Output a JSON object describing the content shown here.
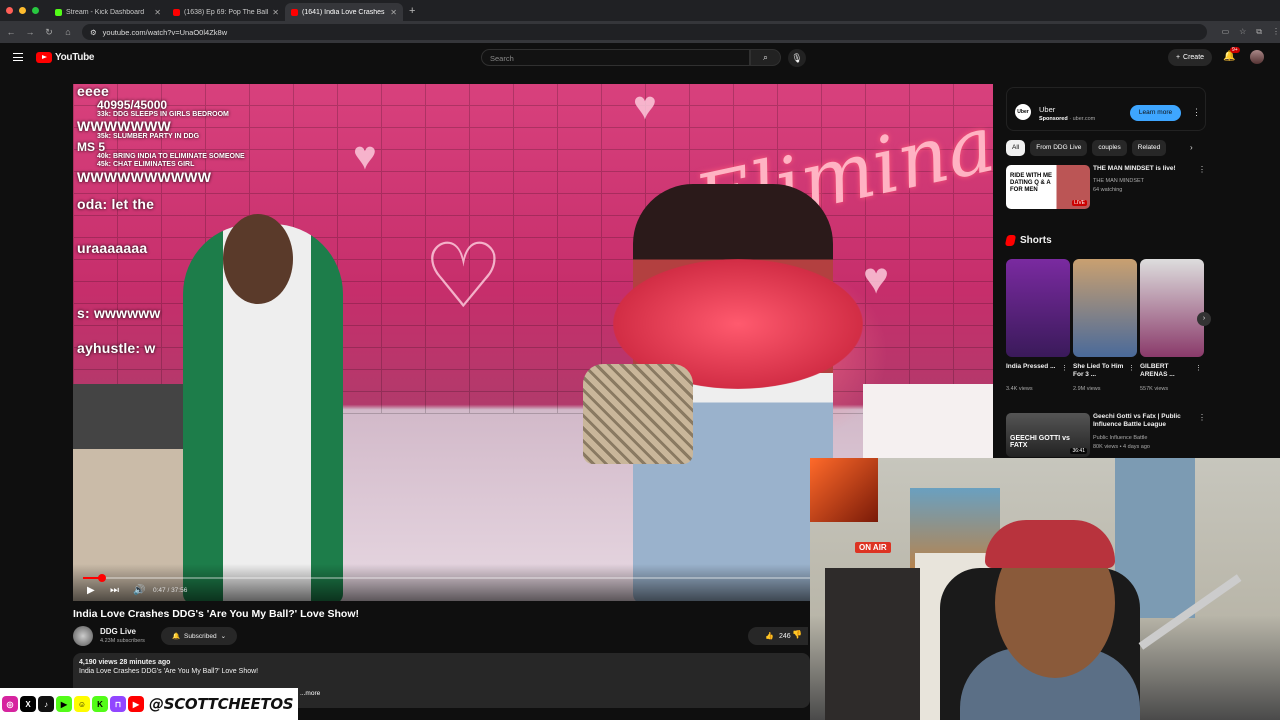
{
  "browser": {
    "tabs": [
      {
        "title": "Stream - Kick Dashboard",
        "color": "#53fc18",
        "active": false
      },
      {
        "title": "(1638) Ep 69: Pop The Balloo",
        "color": "#ff0000",
        "active": false
      },
      {
        "title": "(1641) India Love Crashes DDG",
        "color": "#ff0000",
        "active": true
      }
    ],
    "url": "youtube.com/watch?v=UnaO0l4Zk8w"
  },
  "header": {
    "logo_text": "YouTube",
    "search_placeholder": "Search",
    "create_label": "Create",
    "notif_count": "9+"
  },
  "video": {
    "overlay": {
      "line1": "eeee",
      "goal": "40995/45000",
      "g1": "33k: DDG SLEEPS IN GIRLS BEDROOM",
      "w1": "WWWWWWW",
      "g2": "35k: SLUMBER PARTY IN DDG",
      "ms": "MS 5",
      "g3": "40k: BRING INDIA TO ELIMINATE SOMEONE",
      "g4": "45k: CHAT ELIMINATES GIRL",
      "w2": "WWWWWWWWWW",
      "chat1": "oda: let the",
      "chat2": "uraaaaaaa",
      "chat3": "s: wwwwww",
      "chat4": "ayhustle: w"
    },
    "sign_text": "Eliminati",
    "progress": 0.021,
    "time": "0:47 / 37:56"
  },
  "meta": {
    "title": "India Love Crashes DDG's 'Are You My Ball?' Love Show!",
    "channel": "DDG Live",
    "subscribers": "4.23M subscribers",
    "subscribed_label": "Subscribed",
    "likes": "246",
    "views_time": "4,190 views  28 minutes ago",
    "description": "India Love Crashes DDG's 'Are You My Ball?' Love Show!",
    "more": "...more"
  },
  "social": {
    "handle": "@SCOTTCHEETOS"
  },
  "sidebar": {
    "ad": {
      "logo": "Uber",
      "name": "Uber",
      "sponsored": "Sponsored",
      "domain": "uber.com",
      "cta": "Learn more"
    },
    "chips": [
      "All",
      "From DDG Live",
      "couples",
      "Related"
    ],
    "recs": [
      {
        "title": "THE MAN MINDSET  is live!",
        "channel": "THE MAN MINDSET",
        "meta": "64 watching",
        "thumb_text": "RIDE WITH ME DATING Q & A FOR MEN",
        "badge": "LIVE"
      },
      {
        "title": "Geechi Gotti vs Fatx | Public Influence Battle League",
        "channel": "Public Influence Battle",
        "meta": "80K views • 4 days ago",
        "thumb_text": "GEECHI GOTTI vs FATX",
        "badge": "36:41"
      }
    ],
    "shorts_label": "Shorts",
    "shorts": [
      {
        "title": "India Pressed ...",
        "views": "3.4K views"
      },
      {
        "title": "She Lied To Him For 3 ...",
        "views": "2.9M views"
      },
      {
        "title": "GILBERT ARENAS ...",
        "views": "557K views"
      }
    ]
  }
}
